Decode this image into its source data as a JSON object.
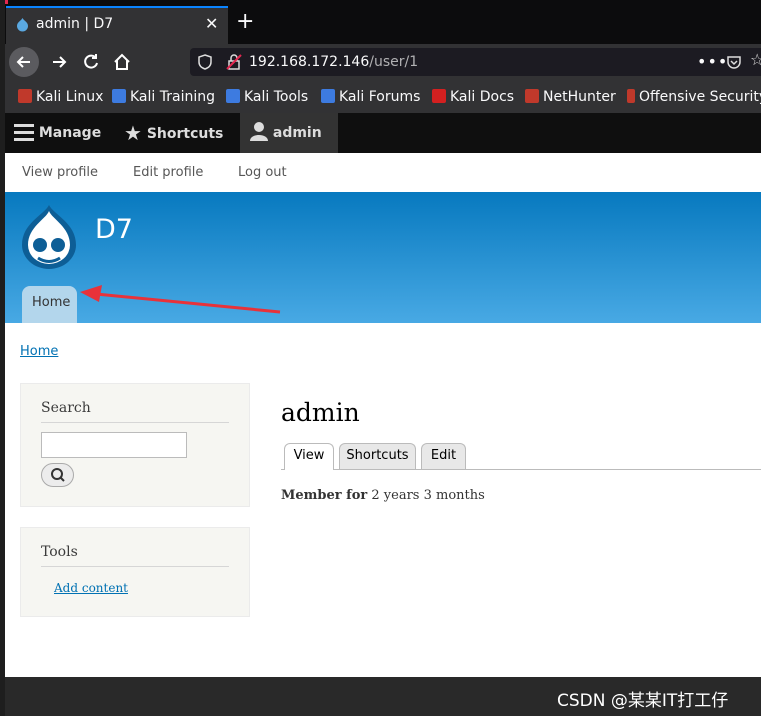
{
  "browser": {
    "tab_title": "admin | D7",
    "tab_close": "✕",
    "new_tab": "+",
    "url_host": "192.168.172.146",
    "url_path": "/user/1",
    "bookmarks": [
      "Kali Linux",
      "Kali Training",
      "Kali Tools",
      "Kali Forums",
      "Kali Docs",
      "NetHunter",
      "Offensive Security"
    ]
  },
  "toolbar": {
    "manage": "Manage",
    "shortcuts": "Shortcuts",
    "admin": "admin",
    "tray_links": [
      "View profile",
      "Edit profile",
      "Log out"
    ]
  },
  "site": {
    "name": "D7",
    "home_tab": "Home"
  },
  "breadcrumb": "Home",
  "sidebar": {
    "search_title": "Search",
    "tools_title": "Tools",
    "add_content": "Add content"
  },
  "page": {
    "title": "admin",
    "tabs": [
      "View",
      "Shortcuts",
      "Edit"
    ],
    "member_label": "Member for",
    "member_value": "2 years 3 months"
  },
  "watermark": "CSDN @某某IT打工仔",
  "colors": {
    "accent": "#0a84ff",
    "header_top": "#0779bf",
    "link": "#0071b3",
    "annotation_arrow": "#e8323a"
  }
}
